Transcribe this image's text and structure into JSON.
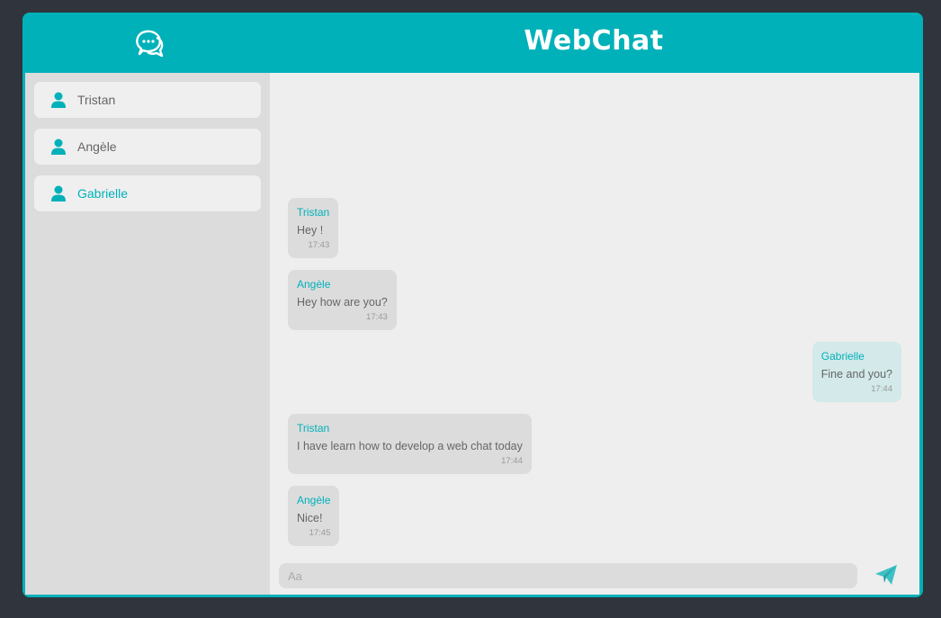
{
  "app": {
    "title": "WebChat",
    "accent": "#00b1b9"
  },
  "contacts": [
    {
      "name": "Tristan",
      "active": false,
      "icon": "user-icon"
    },
    {
      "name": "Angèle",
      "active": false,
      "icon": "user-icon"
    },
    {
      "name": "Gabrielle",
      "active": true,
      "icon": "user-icon"
    }
  ],
  "messages": [
    {
      "author": "Tristan",
      "text": "Hey !",
      "time": "17:43",
      "mine": false
    },
    {
      "author": "Angèle",
      "text": "Hey how are you?",
      "time": "17:43",
      "mine": false
    },
    {
      "author": "Gabrielle",
      "text": "Fine and you?",
      "time": "17:44",
      "mine": true
    },
    {
      "author": "Tristan",
      "text": "I have learn how to develop a web chat today",
      "time": "17:44",
      "mine": false
    },
    {
      "author": "Angèle",
      "text": "Nice!",
      "time": "17:45",
      "mine": false
    }
  ],
  "composer": {
    "placeholder": "Aa",
    "send_icon": "paper-plane-icon"
  }
}
